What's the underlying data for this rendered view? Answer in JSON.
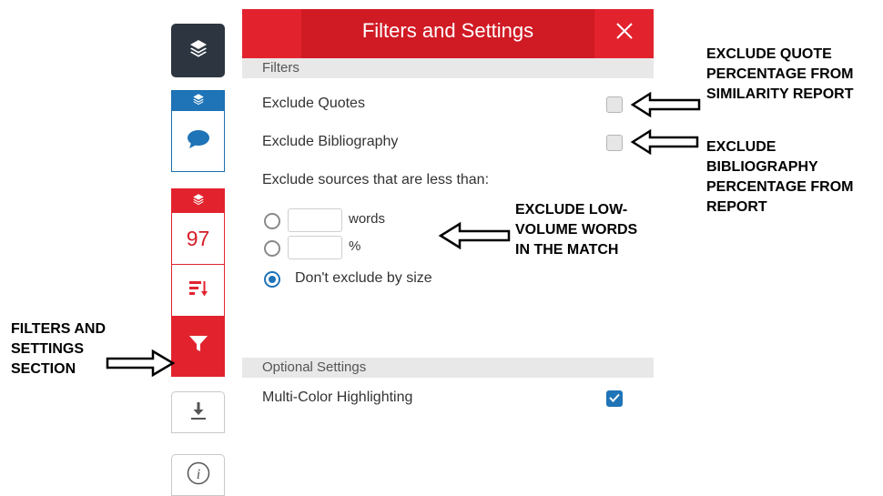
{
  "toolbar": {
    "score": "97",
    "icons": {
      "layers": "layers-icon",
      "comment": "comment-icon",
      "sort": "sort-icon",
      "filter": "filter-icon",
      "download": "download-icon",
      "info": "info-icon"
    }
  },
  "panel": {
    "title": "Filters and Settings",
    "close_symbol": "×",
    "filters_heading": "Filters",
    "exclude_quotes": {
      "label": "Exclude Quotes",
      "checked": false
    },
    "exclude_bibliography": {
      "label": "Exclude Bibliography",
      "checked": false
    },
    "exclude_sources_label": "Exclude sources that are less than:",
    "size_options": [
      {
        "unit": "words",
        "value": "",
        "selected": false
      },
      {
        "unit": "%",
        "value": "",
        "selected": false
      },
      {
        "label": "Don't exclude by size",
        "selected": true
      }
    ],
    "optional_heading": "Optional Settings",
    "multi_color": {
      "label": "Multi-Color Highlighting",
      "checked": true
    }
  },
  "annotations": {
    "quote": [
      "EXCLUDE QUOTE",
      "PERCENTAGE FROM",
      "SIMILARITY REPORT"
    ],
    "bibliography": [
      "EXCLUDE",
      "BIBLIOGRAPHY",
      "PERCENTAGE FROM",
      "REPORT"
    ],
    "low_volume": [
      "EXCLUDE LOW-",
      "VOLUME WORDS",
      "IN THE MATCH"
    ],
    "filters_section": [
      "FILTERS AND",
      "SETTINGS",
      "SECTION"
    ]
  },
  "colors": {
    "brand_red": "#e2232e",
    "title_red": "#d01a24",
    "dark_button": "#2d3640",
    "accent_blue": "#1f73b7",
    "section_gray": "#e8e8e8"
  }
}
